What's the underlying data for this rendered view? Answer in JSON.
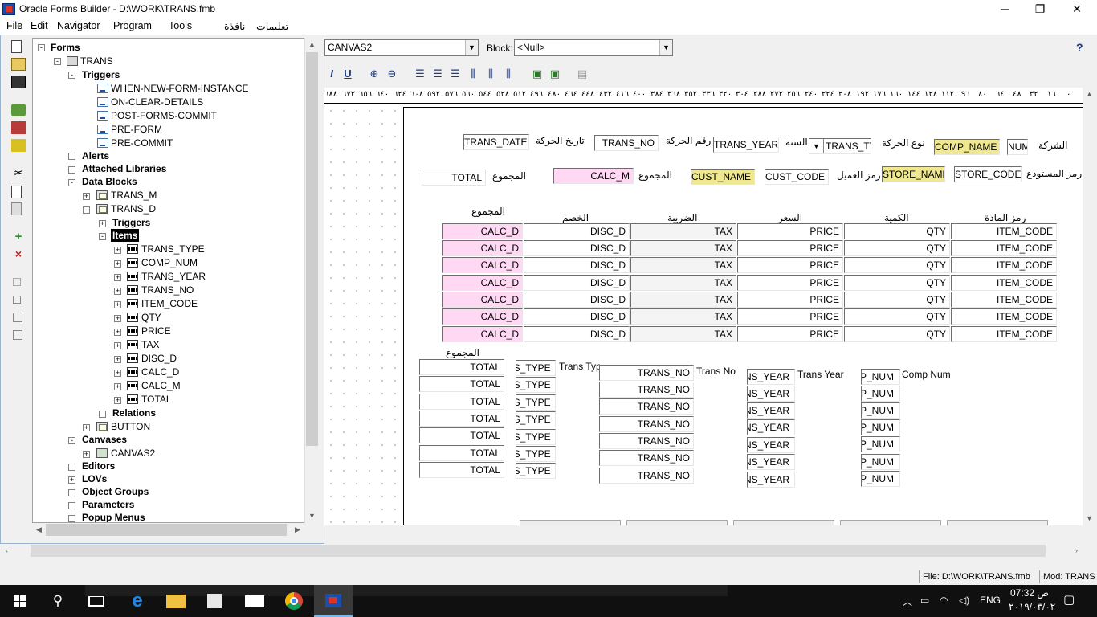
{
  "window": {
    "title": "Oracle Forms Builder - D:\\WORK\\TRANS.fmb",
    "minimize": "─",
    "maximize": "❐",
    "close": "✕"
  },
  "menu": [
    "File",
    "Edit",
    "Navigator",
    "Program",
    "Tools",
    "نافذة",
    "تعليمات"
  ],
  "navigator": {
    "root": "Forms",
    "form": "TRANS",
    "triggers_label": "Triggers",
    "form_triggers": [
      "WHEN-NEW-FORM-INSTANCE",
      "ON-CLEAR-DETAILS",
      "POST-FORMS-COMMIT",
      "PRE-FORM",
      "PRE-COMMIT"
    ],
    "alerts": "Alerts",
    "attached_libraries": "Attached Libraries",
    "data_blocks": "Data Blocks",
    "block_m": "TRANS_M",
    "block_d": "TRANS_D",
    "block_d_triggers": "Triggers",
    "items_label": "Items",
    "items": [
      "TRANS_TYPE",
      "COMP_NUM",
      "TRANS_YEAR",
      "TRANS_NO",
      "ITEM_CODE",
      "QTY",
      "PRICE",
      "TAX",
      "DISC_D",
      "CALC_D",
      "CALC_M",
      "TOTAL"
    ],
    "relations": "Relations",
    "button_block": "BUTTON",
    "canvases": "Canvases",
    "canvas2": "CANVAS2",
    "editors": "Editors",
    "lovs": "LOVs",
    "object_groups": "Object Groups",
    "parameters": "Parameters",
    "popup_menus": "Popup Menus"
  },
  "editor": {
    "canvas_combo": "CANVAS2",
    "block_label": "Block:",
    "block_combo": "<Null>",
    "ruler": [
      "٦٨٨",
      "٦٧٢",
      "٦٥٦",
      "٦٤٠",
      "٦٢٤",
      "٦٠٨",
      "٥٩٢",
      "٥٧٦",
      "٥٦٠",
      "٥٤٤",
      "٥٢٨",
      "٥١٢",
      "٤٩٦",
      "٤٨٠",
      "٤٦٤",
      "٤٤٨",
      "٤٣٢",
      "٤١٦",
      "٤٠٠",
      "٣٨٤",
      "٣٦٨",
      "٣٥٢",
      "٣٣٦",
      "٣٢٠",
      "٣٠٤",
      "٢٨٨",
      "٢٧٢",
      "٢٥٦",
      "٢٤٠",
      "٢٢٤",
      "٢٠٨",
      "١٩٢",
      "١٧٦",
      "١٦٠",
      "١٤٤",
      "١٢٨",
      "١١٢",
      "٩٦",
      "٨٠",
      "٦٤",
      "٤٨",
      "٣٢",
      "١٦",
      "٠"
    ]
  },
  "header_fields": {
    "trans_date": "TRANS_DATE",
    "trans_date_label": "تاريخ الحركة",
    "trans_no": "TRANS_NO",
    "trans_no_label": "رقم الحركة",
    "trans_year": "TRANS_YEAR",
    "trans_year_label": "السنة",
    "trans_type": "TRANS_TYPE",
    "trans_type_label": "نوع الحركة",
    "comp_name": "COMP_NAME",
    "comp_num": "NUM",
    "company_label": "الشركة",
    "total": "TOTAL",
    "total_label": "المجموع",
    "calc_m": "CALC_M",
    "calc_m_label": "المجموع",
    "cust_name": "CUST_NAME",
    "cust_code": "CUST_CODE",
    "cust_label": "رمز العميل",
    "store_name": "STORE_NAME",
    "store_code": "STORE_CODE",
    "store_label": "رمز المستودع"
  },
  "detail": {
    "headers": {
      "calc_d": "المجموع",
      "disc_d": "الخصم",
      "tax": "الضريبة",
      "price": "السعر",
      "qty": "الكمية",
      "item_code": "رمز المادة"
    },
    "row": {
      "calc_d": "CALC_D",
      "disc_d": "DISC_D",
      "tax": "TAX",
      "price": "PRICE",
      "qty": "QTY",
      "item_code": "ITEM_CODE"
    },
    "row_count": 7
  },
  "lower": {
    "total_header": "المجموع",
    "total": "TOTAL",
    "trans_type": "NS_TYPE",
    "trans_type_label": "Trans Typ",
    "trans_no": "TRANS_NO",
    "trans_no_label": "Trans No",
    "trans_year": "ANS_YEAR",
    "trans_year_label": "Trans Year",
    "comp_num": "MP_NUM",
    "comp_num_label": "Comp Num"
  },
  "status": {
    "file": "File: D:\\WORK\\TRANS.fmb",
    "mod": "Mod: TRANS"
  },
  "taskbar": {
    "lang": "ENG",
    "time": "07:32 ص",
    "date": "٢٠١٩/٠٣/٠٢"
  }
}
